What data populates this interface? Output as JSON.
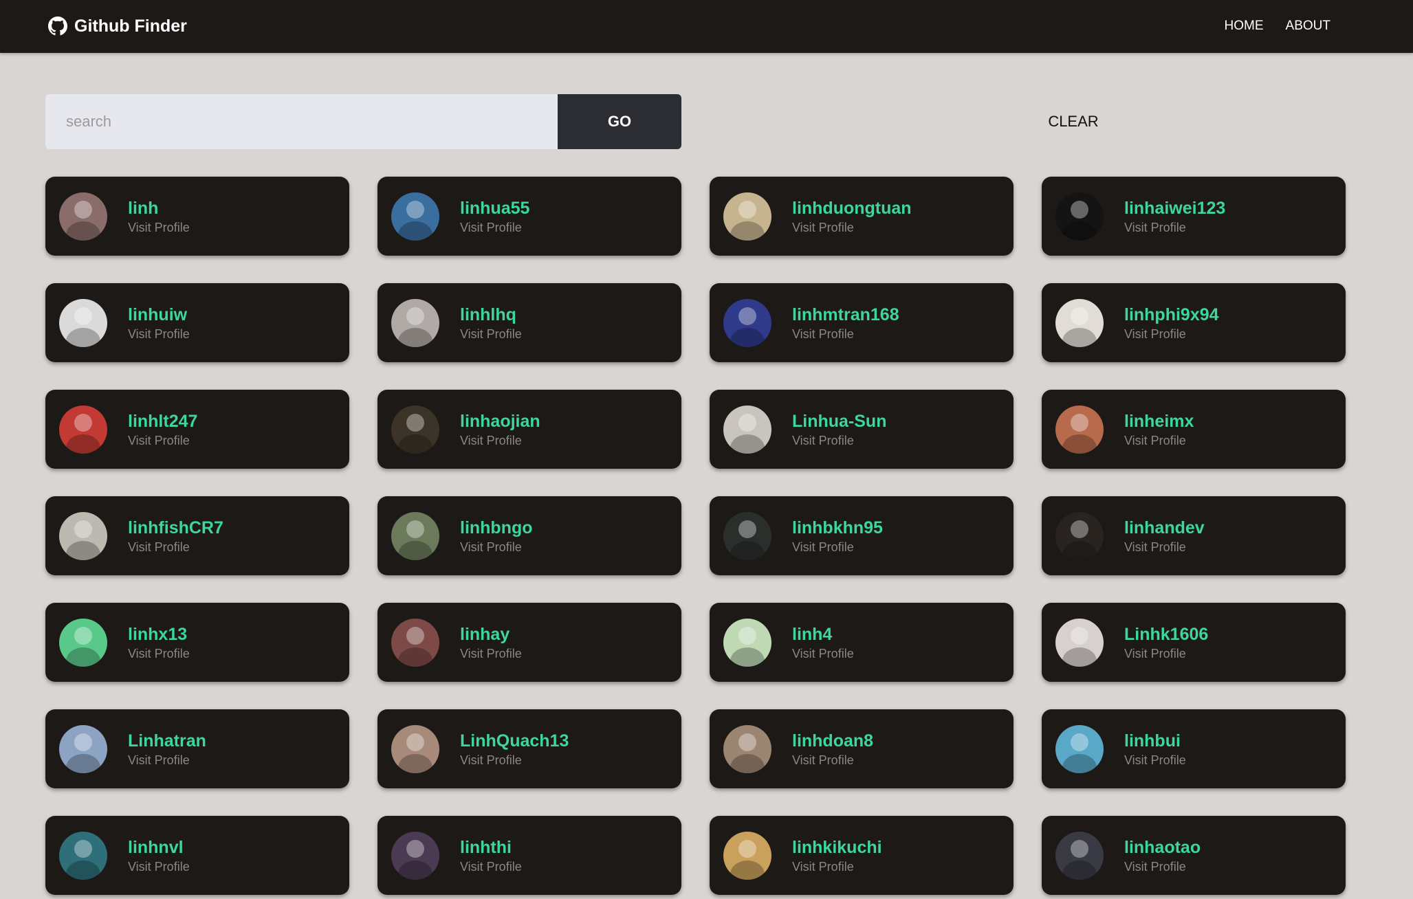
{
  "navbar": {
    "brand": "Github Finder",
    "brand_icon": "github-icon",
    "links": [
      "HOME",
      "ABOUT"
    ]
  },
  "search": {
    "placeholder": "search",
    "value": "",
    "go_label": "GO",
    "clear_label": "CLEAR"
  },
  "colors": {
    "navbar_bg": "#1d1917",
    "page_bg": "#d8d5d3",
    "card_bg": "#1d1917",
    "username": "#3cd6a0",
    "subtext": "#8b8784",
    "go_bg": "#2b2d33",
    "input_bg": "#e7e8ed"
  },
  "users": [
    {
      "login": "linh",
      "link_label": "Visit Profile",
      "avatar_color": "#8a6d6a"
    },
    {
      "login": "linhua55",
      "link_label": "Visit Profile",
      "avatar_color": "#3a6e9e"
    },
    {
      "login": "linhduongtuan",
      "link_label": "Visit Profile",
      "avatar_color": "#c6b48f"
    },
    {
      "login": "linhaiwei123",
      "link_label": "Visit Profile",
      "avatar_color": "#141414"
    },
    {
      "login": "linhuiw",
      "link_label": "Visit Profile",
      "avatar_color": "#dadada"
    },
    {
      "login": "linhlhq",
      "link_label": "Visit Profile",
      "avatar_color": "#b0a9a5"
    },
    {
      "login": "linhmtran168",
      "link_label": "Visit Profile",
      "avatar_color": "#2f3b8a"
    },
    {
      "login": "linhphi9x94",
      "link_label": "Visit Profile",
      "avatar_color": "#e2dcd6"
    },
    {
      "login": "linhlt247",
      "link_label": "Visit Profile",
      "avatar_color": "#c23a33"
    },
    {
      "login": "linhaojian",
      "link_label": "Visit Profile",
      "avatar_color": "#3c3428"
    },
    {
      "login": "Linhua-Sun",
      "link_label": "Visit Profile",
      "avatar_color": "#c9c4bd"
    },
    {
      "login": "linheimx",
      "link_label": "Visit Profile",
      "avatar_color": "#b86a4d"
    },
    {
      "login": "linhfishCR7",
      "link_label": "Visit Profile",
      "avatar_color": "#bdb8b0"
    },
    {
      "login": "linhbngo",
      "link_label": "Visit Profile",
      "avatar_color": "#6a7a5a"
    },
    {
      "login": "linhbkhn95",
      "link_label": "Visit Profile",
      "avatar_color": "#2b2f2c"
    },
    {
      "login": "linhandev",
      "link_label": "Visit Profile",
      "avatar_color": "#2a2420"
    },
    {
      "login": "linhx13",
      "link_label": "Visit Profile",
      "avatar_color": "#59c98a"
    },
    {
      "login": "linhay",
      "link_label": "Visit Profile",
      "avatar_color": "#7e4a48"
    },
    {
      "login": "linh4",
      "link_label": "Visit Profile",
      "avatar_color": "#bfd9b4"
    },
    {
      "login": "Linhk1606",
      "link_label": "Visit Profile",
      "avatar_color": "#d8d0d0"
    },
    {
      "login": "Linhatran",
      "link_label": "Visit Profile",
      "avatar_color": "#8da3c4"
    },
    {
      "login": "LinhQuach13",
      "link_label": "Visit Profile",
      "avatar_color": "#a88a7a"
    },
    {
      "login": "linhdoan8",
      "link_label": "Visit Profile",
      "avatar_color": "#9b8470"
    },
    {
      "login": "linhbui",
      "link_label": "Visit Profile",
      "avatar_color": "#5aa8c8"
    },
    {
      "login": "linhnvl",
      "link_label": "Visit Profile",
      "avatar_color": "#2e6f7a"
    },
    {
      "login": "linhthi",
      "link_label": "Visit Profile",
      "avatar_color": "#4a3a52"
    },
    {
      "login": "linhkikuchi",
      "link_label": "Visit Profile",
      "avatar_color": "#c9a05c"
    },
    {
      "login": "linhaotao",
      "link_label": "Visit Profile",
      "avatar_color": "#3a3a44"
    }
  ]
}
